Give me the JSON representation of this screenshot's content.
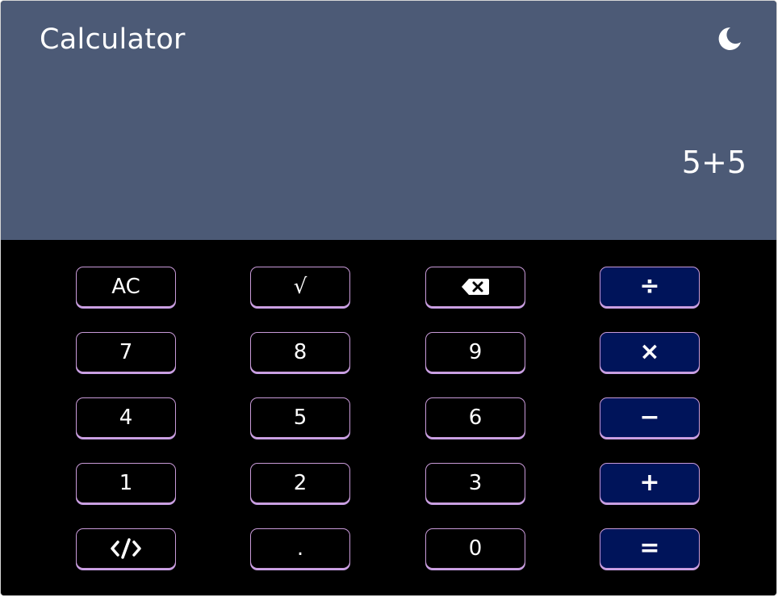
{
  "header": {
    "title": "Calculator",
    "theme_icon": "moon-icon"
  },
  "display": {
    "expression": "5+5"
  },
  "keypad": {
    "row1": {
      "clear": "AC",
      "sqrt": "√",
      "backspace_icon": "backspace-icon",
      "divide": "÷"
    },
    "row2": {
      "seven": "7",
      "eight": "8",
      "nine": "9",
      "multiply": "×"
    },
    "row3": {
      "four": "4",
      "five": "5",
      "six": "6",
      "minus": "−"
    },
    "row4": {
      "one": "1",
      "two": "2",
      "three": "3",
      "plus": "+"
    },
    "row5": {
      "code_icon": "code-icon",
      "dot": ".",
      "zero": "0",
      "equals": "="
    }
  },
  "colors": {
    "header_bg": "#4c5a76",
    "keypad_bg": "#000000",
    "operator_bg": "#00145a",
    "key_border": "#c89ad8",
    "text": "#ffffff"
  }
}
